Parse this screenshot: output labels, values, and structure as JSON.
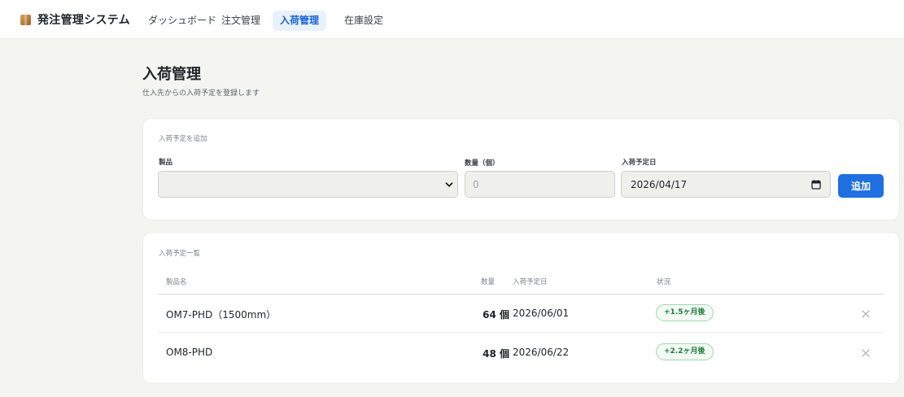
{
  "app": {
    "title": "発注管理システム",
    "icon": "package-icon"
  },
  "nav": {
    "tabs": [
      {
        "label": "ダッシュボード",
        "active": false
      },
      {
        "label": "注文管理",
        "active": false
      },
      {
        "label": "入荷管理",
        "active": true
      },
      {
        "label": "在庫設定",
        "active": false
      }
    ]
  },
  "page": {
    "title": "入荷管理",
    "subtitle": "仕入先からの入荷予定を登録します"
  },
  "form": {
    "title": "入荷予定を追加",
    "product_label": "製品",
    "product_value": "",
    "quantity_label": "数量（個）",
    "quantity_placeholder": "0",
    "date_label": "入荷予定日",
    "date_value": "2026/04/17",
    "add_button": "追加"
  },
  "list": {
    "title": "入荷予定一覧",
    "columns": {
      "product": "製品名",
      "quantity": "数量",
      "date": "入荷予定日",
      "status": "状況"
    },
    "rows": [
      {
        "product": "OM7-PHD（1500mm）",
        "quantity": "64 個",
        "date": "2026/06/01",
        "status": "+1.5ヶ月後"
      },
      {
        "product": "OM8-PHD",
        "quantity": "48 個",
        "date": "2026/06/22",
        "status": "+2.2ヶ月後"
      }
    ]
  },
  "colors": {
    "accent": "#1e6fe0",
    "active_tab_bg": "#e9f1fd",
    "status_green": "#1f7a3a",
    "page_bg": "#f4f4f1"
  }
}
